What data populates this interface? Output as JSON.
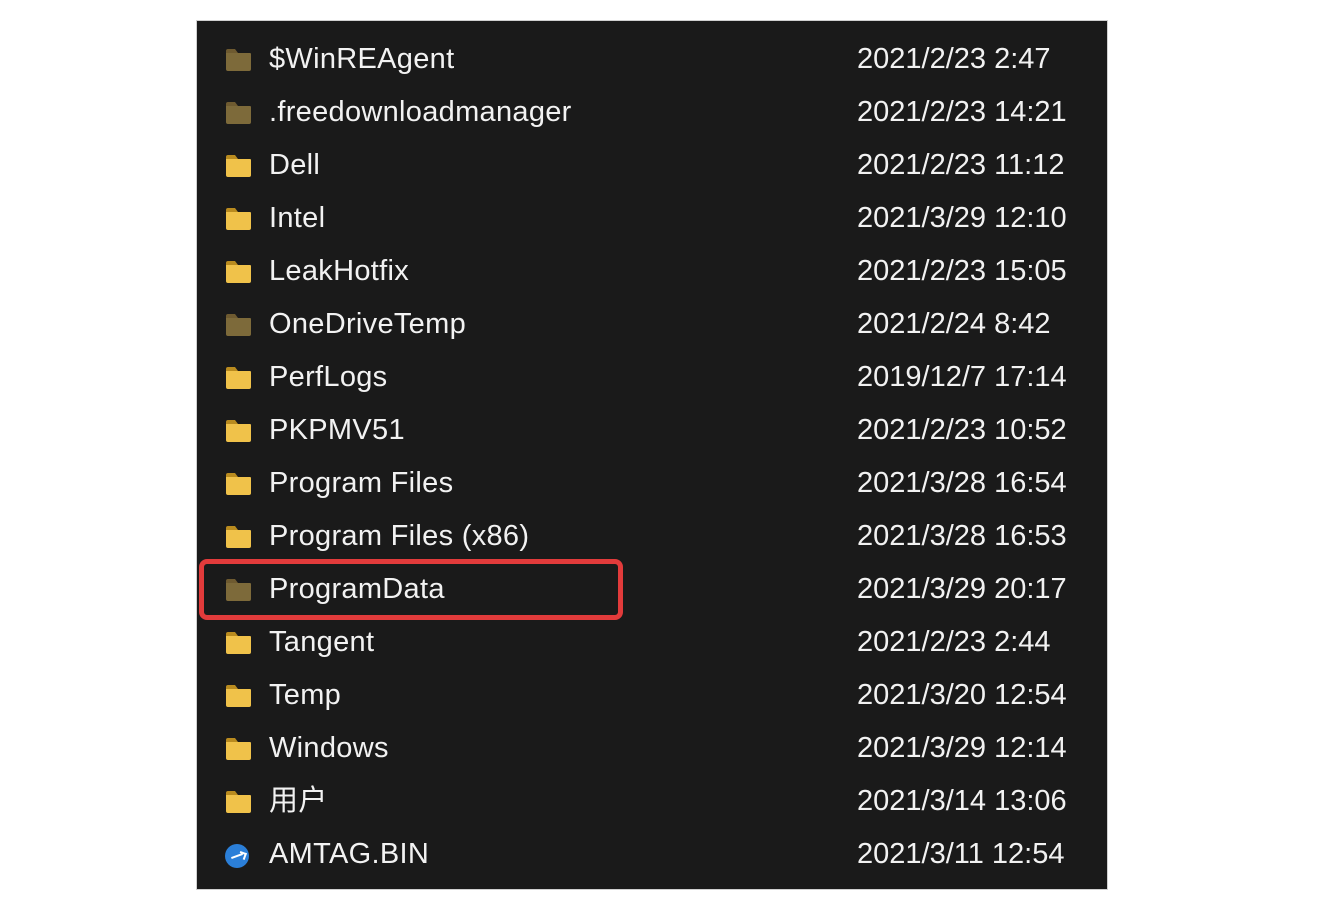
{
  "colors": {
    "background": "#1a1a1a",
    "text": "#f2f2f2",
    "highlight_border": "#e23b3b",
    "folder_normal_body": "#f0c24a",
    "folder_normal_tab": "#b98b1f",
    "folder_hidden_body": "#7d6a3a",
    "folder_hidden_tab": "#6e5a30",
    "file_blue": "#2b7fd8"
  },
  "highlighted_index": 10,
  "items": [
    {
      "name": "$WinREAgent",
      "date": "2021/2/23 2:47",
      "icon": "folder",
      "style": "hidden"
    },
    {
      "name": ".freedownloadmanager",
      "date": "2021/2/23 14:21",
      "icon": "folder",
      "style": "hidden"
    },
    {
      "name": "Dell",
      "date": "2021/2/23 11:12",
      "icon": "folder",
      "style": "normal"
    },
    {
      "name": "Intel",
      "date": "2021/3/29 12:10",
      "icon": "folder",
      "style": "normal"
    },
    {
      "name": "LeakHotfix",
      "date": "2021/2/23 15:05",
      "icon": "folder",
      "style": "normal"
    },
    {
      "name": "OneDriveTemp",
      "date": "2021/2/24 8:42",
      "icon": "folder",
      "style": "hidden"
    },
    {
      "name": "PerfLogs",
      "date": "2019/12/7 17:14",
      "icon": "folder",
      "style": "normal"
    },
    {
      "name": "PKPMV51",
      "date": "2021/2/23 10:52",
      "icon": "folder",
      "style": "normal"
    },
    {
      "name": "Program Files",
      "date": "2021/3/28 16:54",
      "icon": "folder",
      "style": "normal"
    },
    {
      "name": "Program Files (x86)",
      "date": "2021/3/28 16:53",
      "icon": "folder",
      "style": "normal"
    },
    {
      "name": "ProgramData",
      "date": "2021/3/29 20:17",
      "icon": "folder",
      "style": "hidden"
    },
    {
      "name": "Tangent",
      "date": "2021/2/23 2:44",
      "icon": "folder",
      "style": "normal"
    },
    {
      "name": "Temp",
      "date": "2021/3/20 12:54",
      "icon": "folder",
      "style": "normal"
    },
    {
      "name": "Windows",
      "date": "2021/3/29 12:14",
      "icon": "folder",
      "style": "normal"
    },
    {
      "name": "用户",
      "date": "2021/3/14 13:06",
      "icon": "folder",
      "style": "normal"
    },
    {
      "name": "AMTAG.BIN",
      "date": "2021/3/11 12:54",
      "icon": "file",
      "style": "blue"
    }
  ]
}
